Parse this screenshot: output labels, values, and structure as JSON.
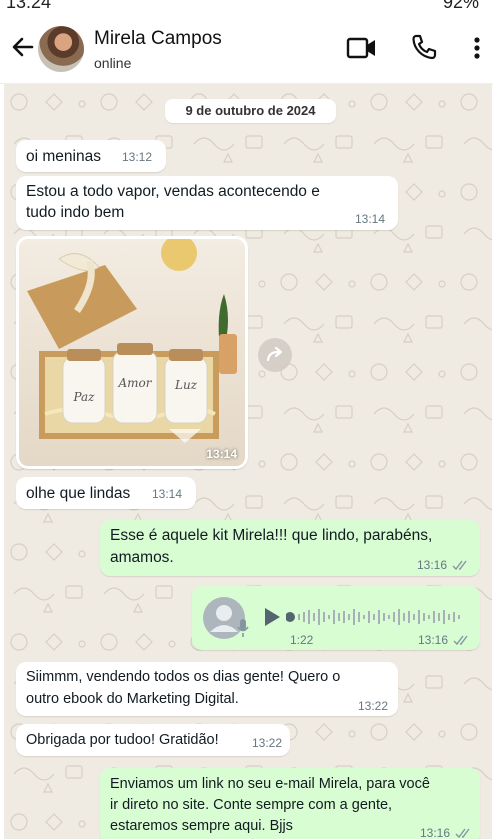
{
  "statusbar": {
    "time": "13:24",
    "battery": "92%"
  },
  "header": {
    "contact_name": "Mirela Campos",
    "contact_status": "online"
  },
  "chat": {
    "date_chip": "9 de outubro de 2024",
    "messages": [
      {
        "direction": "in",
        "text": "oi meninas",
        "time": "13:12"
      },
      {
        "direction": "in",
        "lines": [
          "Estou a todo vapor, vendas acontecendo e",
          "tudo indo bem"
        ],
        "time": "13:14"
      },
      {
        "direction": "in",
        "type": "image",
        "image": "photo of a gift box with three candles labelled Paz, Amor, Luz",
        "candle_labels": [
          "Paz",
          "Amor",
          "Luz"
        ],
        "time": "13:14"
      },
      {
        "direction": "in",
        "text": "olhe que lindas",
        "time": "13:14"
      },
      {
        "direction": "out",
        "lines": [
          "Esse é aquele kit Mirela!!! que lindo, parabéns,",
          "amamos."
        ],
        "time": "13:16"
      },
      {
        "direction": "out",
        "type": "voice",
        "duration": "1:22",
        "time": "13:16"
      },
      {
        "direction": "in",
        "lines": [
          "Siimmm, vendendo todos os dias gente! Quero o",
          "outro ebook do Marketing Digital."
        ],
        "time": "13:22"
      },
      {
        "direction": "in",
        "text": "Obrigada por tudoo! Gratidão!",
        "time": "13:22"
      },
      {
        "direction": "out",
        "lines": [
          "Enviamos um link no seu e-mail Mirela, para você",
          "ir direto no site. Conte sempre com a gente,",
          "estaremos sempre aqui. Bjjs"
        ],
        "time": "13:16"
      }
    ]
  },
  "icons": {
    "back": "arrow-left-icon",
    "video": "video-camera-icon",
    "call": "phone-icon",
    "menu": "more-vertical-icon",
    "forward": "forward-icon",
    "play": "play-icon",
    "mic": "microphone-icon",
    "read_receipt": "double-check-icon"
  },
  "colors": {
    "chat_background": "#efeae2",
    "incoming_bubble": "#ffffff",
    "outgoing_bubble": "#d9fdd3",
    "timestamp": "#667781",
    "read_ticks": "#8696a0"
  }
}
